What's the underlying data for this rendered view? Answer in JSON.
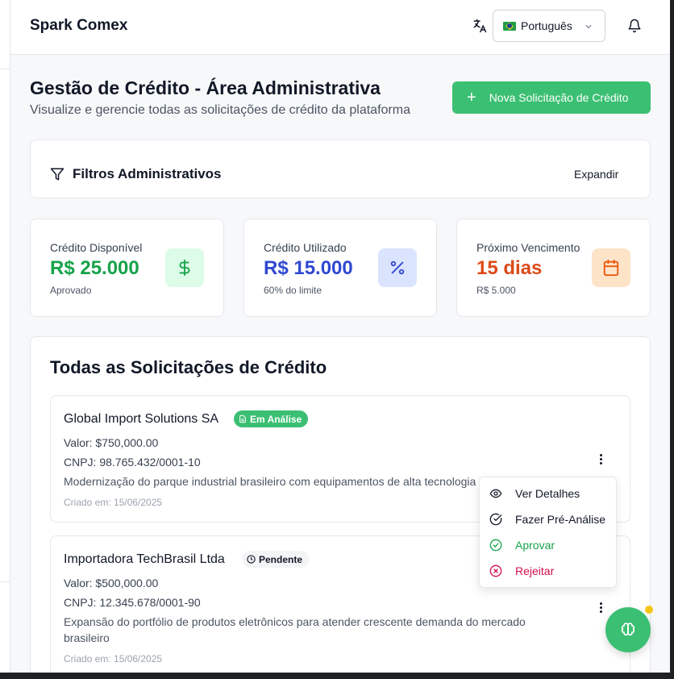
{
  "app": {
    "brand": "Spark Comex"
  },
  "header": {
    "language": {
      "flag": "🇧🇷",
      "selected": "Português"
    }
  },
  "page": {
    "title": "Gestão de Crédito - Área Administrativa",
    "subtitle": "Visualize e gerencie todas as solicitações de crédito da plataforma",
    "new_button": "Nova Solicitação de Crédito"
  },
  "filters": {
    "title": "Filtros Administrativos",
    "toggle": "Expandir"
  },
  "stats": [
    {
      "label": "Crédito Disponível",
      "value": "R$ 25.000",
      "note": "Aprovado",
      "icon": "dollar-icon",
      "color": "#16a34a",
      "icon_bg": "#dcfce7"
    },
    {
      "label": "Crédito Utilizado",
      "value": "R$ 15.000",
      "note": "60% do limite",
      "icon": "percent-icon",
      "color": "#2f49d1",
      "icon_bg": "#dbe4fe"
    },
    {
      "label": "Próximo Vencimento",
      "value": "15 dias",
      "note": "R$ 5.000",
      "icon": "calendar-icon",
      "color": "#dc4a17",
      "icon_bg": "#fde4c9"
    }
  ],
  "requests": {
    "title": "Todas as Solicitações de Crédito",
    "items": [
      {
        "company": "Global Import Solutions SA",
        "status": "Em Análise",
        "value": "Valor: $750,000.00",
        "cnpj": "CNPJ: 98.765.432/0001-10",
        "description": "Modernização do parque industrial brasileiro com equipamentos de alta tecnologia",
        "created": "Criado em: 15/06/2025"
      },
      {
        "company": "Importadora TechBrasil Ltda",
        "status": "Pendente",
        "value": "Valor: $500,000.00",
        "cnpj": "CNPJ: 12.345.678/0001-90",
        "description": "Expansão do portfólio de produtos eletrônicos para atender crescente demanda do mercado brasileiro",
        "created": "Criado em: 15/06/2025"
      }
    ]
  },
  "actions_menu": {
    "items": [
      {
        "label": "Ver Detalhes",
        "icon": "eye-icon",
        "color": "#111827"
      },
      {
        "label": "Fazer Pré-Análise",
        "icon": "check-circle-icon",
        "color": "#111827"
      },
      {
        "label": "Aprovar",
        "icon": "check-circle-icon",
        "color": "#16a34a"
      },
      {
        "label": "Rejeitar",
        "icon": "x-circle-icon",
        "color": "#d0104c"
      }
    ]
  },
  "colors": {
    "accent": "#3bbf73",
    "badge_review": "#3bbf73",
    "badge_pending": "#f3f4f6"
  }
}
